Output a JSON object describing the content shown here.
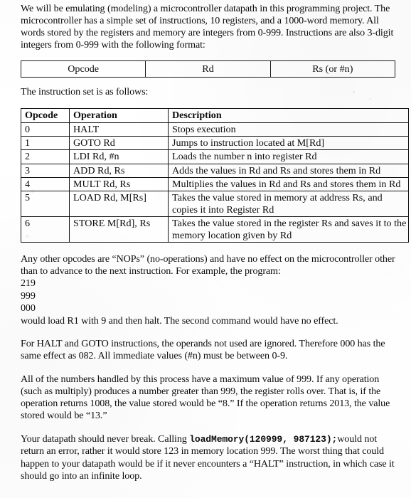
{
  "document": {
    "type": "scanned-course-handout",
    "intro_paragraph": "We will be emulating (modeling) a microcontroller datapath in this programming project.  The microcontroller has a simple set of instructions, 10 registers, and a 1000-word memory.  All words stored by the registers and memory are integers from 0-999.  Instructions are also 3-digit integers from 0-999 with the following format:",
    "instruction_format_table": {
      "cells": [
        "Opcode",
        "Rd",
        "Rs (or #n)"
      ]
    },
    "instruction_set_lead_in": "The instruction set is as follows:",
    "instruction_set_table": {
      "headers": [
        "Opcode",
        "Operation",
        "Description"
      ],
      "rows": [
        {
          "opcode": "0",
          "operation": "HALT",
          "description": "Stops execution"
        },
        {
          "opcode": "1",
          "operation": "GOTO Rd",
          "description": "Jumps to instruction located at M[Rd]"
        },
        {
          "opcode": "2",
          "operation": "LDI  Rd, #n",
          "description": "Loads the number n into register Rd"
        },
        {
          "opcode": "3",
          "operation": "ADD Rd, Rs",
          "description": "Adds the values in Rd and Rs and stores them in Rd"
        },
        {
          "opcode": "4",
          "operation": "MULT Rd, Rs",
          "description": "Multiplies the values in Rd and Rs and stores them in Rd"
        },
        {
          "opcode": "5",
          "operation": "LOAD Rd, M[Rs]",
          "description": "Takes the value stored in memory at address Rs, and copies it into Register Rd"
        },
        {
          "opcode": "6",
          "operation": "STORE M[Rd], Rs",
          "description": "Takes the value stored in the register Rs and saves it to the memory location given by Rd"
        }
      ]
    },
    "nop_paragraph": "Any other opcodes are “NOPs” (no-operations) and have no effect on the microcontroller other than to advance to the next instruction.  For example, the program:",
    "example_program": [
      "219",
      "999",
      "000"
    ],
    "example_result": "would load R1 with 9 and then halt.  The second command would have no effect.",
    "operands_paragraph": "For HALT and GOTO instructions, the operands not used are ignored.  Therefore 000 has the same effect as 082.  All immediate values (#n) must be between 0-9.",
    "rollover_paragraph": "All of the numbers handled by this process have a maximum value of 999.  If any operation (such as multiply) produces a number greater than 999, the register rolls over.  That is, if the operation returns 1008, the value stored would be “8.”  If the operation returns 2013, the value stored would be “13.”",
    "robustness_paragraph": {
      "before_code": "Your datapath should never break.  Calling ",
      "code": "loadMemory(120999, 987123);",
      "after_code": "would not return an error, rather it would store 123 in memory location 999.  The worst thing that could happen to your datapath would be if it never encounters a “HALT” instruction, in which case it should go into an infinite loop."
    }
  }
}
